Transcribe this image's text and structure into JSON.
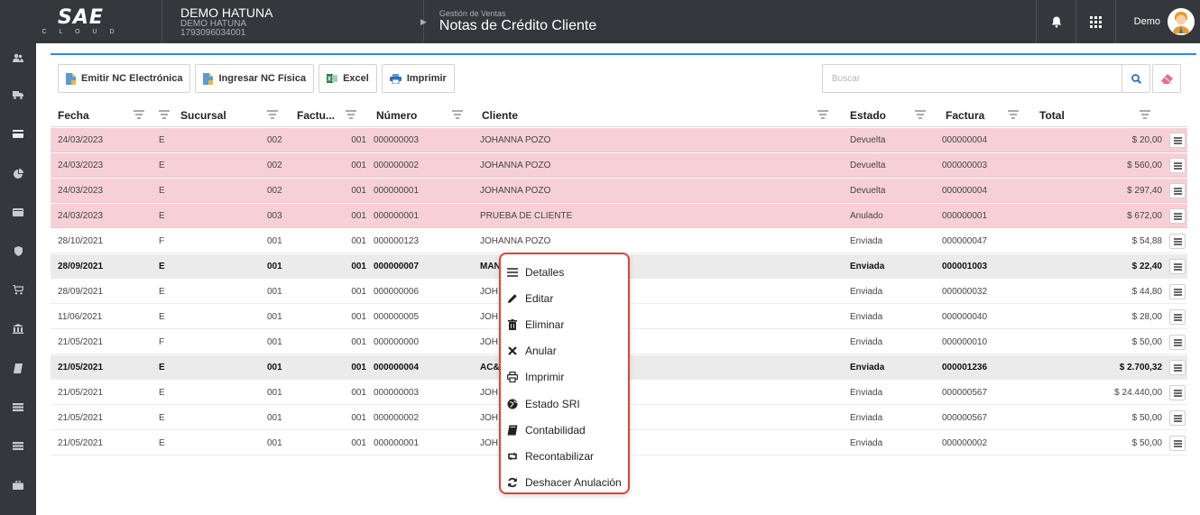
{
  "app": {
    "logo_main": "SAE",
    "logo_sub": "C L O U D"
  },
  "company": {
    "name": "DEMO HATUNA",
    "sub_name": "DEMO HATUNA",
    "ruc": "1793096034001"
  },
  "section": {
    "module": "Gestión de Ventas",
    "title": "Notas de Crédito Cliente"
  },
  "user": {
    "name": "Demo"
  },
  "toolbar": {
    "emit_label": "Emitir NC Electrónica",
    "physical_label": "Ingresar NC Física",
    "excel_label": "Excel",
    "print_label": "Imprimir"
  },
  "search": {
    "placeholder": "Buscar",
    "value": ""
  },
  "table": {
    "columns": {
      "fecha": "Fecha",
      "sucursal": "Sucursal",
      "factura_short": "Factu...",
      "numero": "Número",
      "cliente": "Cliente",
      "estado": "Estado",
      "factura": "Factura",
      "total": "Total"
    },
    "rows": [
      {
        "fecha": "24/03/2023",
        "tipo": "E",
        "sucursal": "002",
        "punto": "001",
        "numero": "000000003",
        "cliente": "JOHANNA POZO",
        "estado": "Devuelta",
        "factura": "000000004",
        "total": "$ 20,00"
      },
      {
        "fecha": "24/03/2023",
        "tipo": "E",
        "sucursal": "002",
        "punto": "001",
        "numero": "000000002",
        "cliente": "JOHANNA POZO",
        "estado": "Devuelta",
        "factura": "000000003",
        "total": "$ 560,00"
      },
      {
        "fecha": "24/03/2023",
        "tipo": "E",
        "sucursal": "002",
        "punto": "001",
        "numero": "000000001",
        "cliente": "JOHANNA POZO",
        "estado": "Devuelta",
        "factura": "000000004",
        "total": "$ 297,40"
      },
      {
        "fecha": "24/03/2023",
        "tipo": "E",
        "sucursal": "003",
        "punto": "001",
        "numero": "000000001",
        "cliente": "PRUEBA DE CLIENTE",
        "estado": "Anulado",
        "factura": "000000001",
        "total": "$ 672,00"
      },
      {
        "fecha": "28/10/2021",
        "tipo": "F",
        "sucursal": "001",
        "punto": "001",
        "numero": "000000123",
        "cliente": "JOHANNA POZO",
        "estado": "Enviada",
        "factura": "000000047",
        "total": "$ 54,88"
      },
      {
        "fecha": "28/09/2021",
        "tipo": "E",
        "sucursal": "001",
        "punto": "001",
        "numero": "000000007",
        "cliente": "MAN",
        "estado": "Enviada",
        "factura": "000001003",
        "total": "$ 22,40"
      },
      {
        "fecha": "28/09/2021",
        "tipo": "E",
        "sucursal": "001",
        "punto": "001",
        "numero": "000000006",
        "cliente": "JOH",
        "estado": "Enviada",
        "factura": "000000032",
        "total": "$ 44,80"
      },
      {
        "fecha": "11/06/2021",
        "tipo": "E",
        "sucursal": "001",
        "punto": "001",
        "numero": "000000005",
        "cliente": "JOH",
        "estado": "Enviada",
        "factura": "000000040",
        "total": "$ 28,00"
      },
      {
        "fecha": "21/05/2021",
        "tipo": "F",
        "sucursal": "001",
        "punto": "001",
        "numero": "000000000",
        "cliente": "JOH",
        "estado": "Enviada",
        "factura": "000000010",
        "total": "$ 50,00"
      },
      {
        "fecha": "21/05/2021",
        "tipo": "E",
        "sucursal": "001",
        "punto": "001",
        "numero": "000000004",
        "cliente": "AC&",
        "estado": "Enviada",
        "factura": "000001236",
        "total": "$ 2.700,32"
      },
      {
        "fecha": "21/05/2021",
        "tipo": "E",
        "sucursal": "001",
        "punto": "001",
        "numero": "000000003",
        "cliente": "JOH",
        "estado": "Enviada",
        "factura": "000000567",
        "total": "$ 24.440,00"
      },
      {
        "fecha": "21/05/2021",
        "tipo": "E",
        "sucursal": "001",
        "punto": "001",
        "numero": "000000002",
        "cliente": "JOH",
        "estado": "Enviada",
        "factura": "000000567",
        "total": "$ 50,00"
      },
      {
        "fecha": "21/05/2021",
        "tipo": "E",
        "sucursal": "001",
        "punto": "001",
        "numero": "000000001",
        "cliente": "JOH",
        "estado": "Enviada",
        "factura": "000000002",
        "total": "$ 50,00"
      }
    ]
  },
  "context_menu": {
    "items": [
      {
        "label": "Detalles",
        "icon": "list-icon"
      },
      {
        "label": "Editar",
        "icon": "pencil-icon"
      },
      {
        "label": "Eliminar",
        "icon": "trash-icon"
      },
      {
        "label": "Anular",
        "icon": "x-icon"
      },
      {
        "label": "Imprimir",
        "icon": "print-icon"
      },
      {
        "label": "Estado SRI",
        "icon": "globe-icon"
      },
      {
        "label": "Contabilidad",
        "icon": "book-icon"
      },
      {
        "label": "Recontabilizar",
        "icon": "retweet-icon"
      },
      {
        "label": "Deshacer Anulación",
        "icon": "refresh-icon"
      }
    ]
  },
  "colors": {
    "topbar": "#34383d",
    "accent": "#2f8fdc",
    "returned_row": "#f6d0d6",
    "selected_row": "#ebebeb",
    "menu_border": "#d9453b"
  }
}
